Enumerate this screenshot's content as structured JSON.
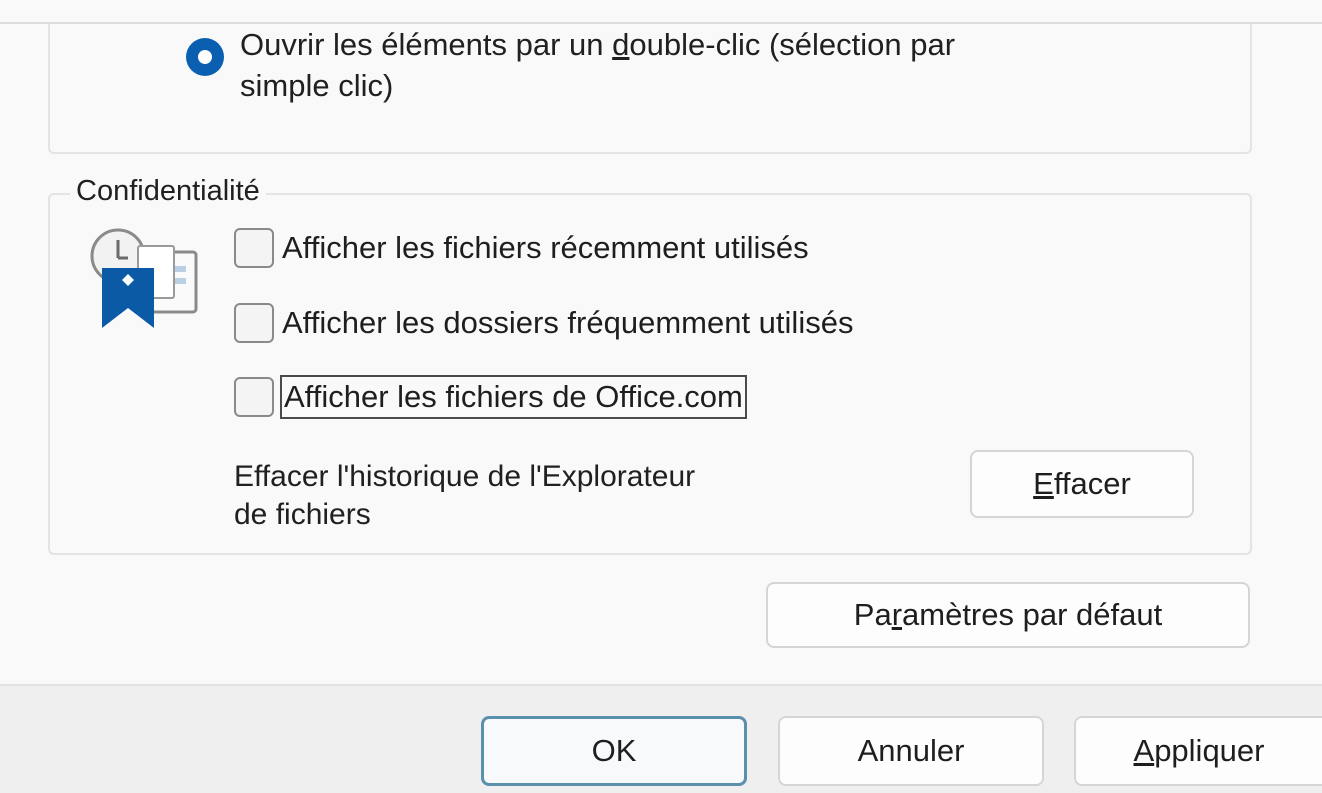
{
  "click_options": {
    "radio_label_line1_pre": "Ouvrir les éléments par un ",
    "radio_label_mnemonic": "d",
    "radio_label_line1_post": "ouble-clic (sélection par",
    "radio_label_line2": "simple clic)",
    "radio_selected": true
  },
  "privacy": {
    "legend": "Confidentialité",
    "icon": "recent-files-icon",
    "checkboxes": [
      {
        "label": "Afficher les fichiers récemment utilisés",
        "checked": false
      },
      {
        "label": "Afficher les dossiers fréquemment utilisés",
        "checked": false
      },
      {
        "label": "Afficher les fichiers de Office.com",
        "checked": false
      }
    ],
    "clear_text_line1": "Effacer l'historique de l'Explorateur",
    "clear_text_line2": "de fichiers",
    "clear_button_mnemonic": "E",
    "clear_button_rest": "ffacer"
  },
  "defaults_button": {
    "pre": "Pa",
    "mnemonic": "r",
    "post": "amètres par défaut"
  },
  "footer": {
    "ok_label": "OK",
    "cancel_label": "Annuler",
    "apply_mnemonic": "A",
    "apply_rest": "ppliquer"
  },
  "colors": {
    "accent": "#0a5fb0",
    "focus_border": "#5a8fae"
  }
}
